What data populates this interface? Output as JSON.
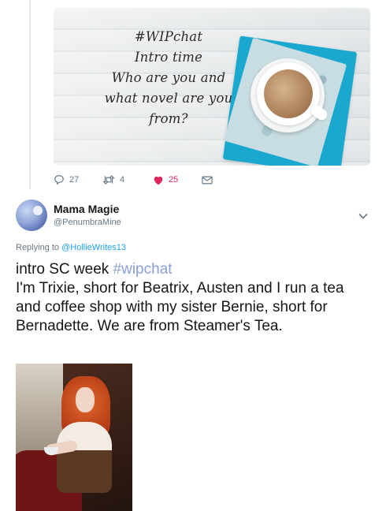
{
  "media_card": {
    "caption_lines": "#WIPchat\nIntro time\nWho are you and\nwhat novel are you\nfrom?"
  },
  "actions": {
    "replies": "27",
    "retweets": "4",
    "likes": "25",
    "like_color": "#e0245e"
  },
  "reply_tweet": {
    "display_name": "Mama Magie",
    "handle": "@PenumbraMine",
    "replying_prefix": "Replying to ",
    "replying_to": "@HollieWrites13",
    "text_before_hashtag": "intro SC week ",
    "hashtag": "#wipchat",
    "text_after_hashtag": "I'm Trixie, short for Beatrix, Austen and I run a tea and coffee shop with my sister Bernie, short for Bernadette.  We are from Steamer's Tea."
  },
  "colors": {
    "link": "#1da1f2",
    "muted": "#657786"
  }
}
